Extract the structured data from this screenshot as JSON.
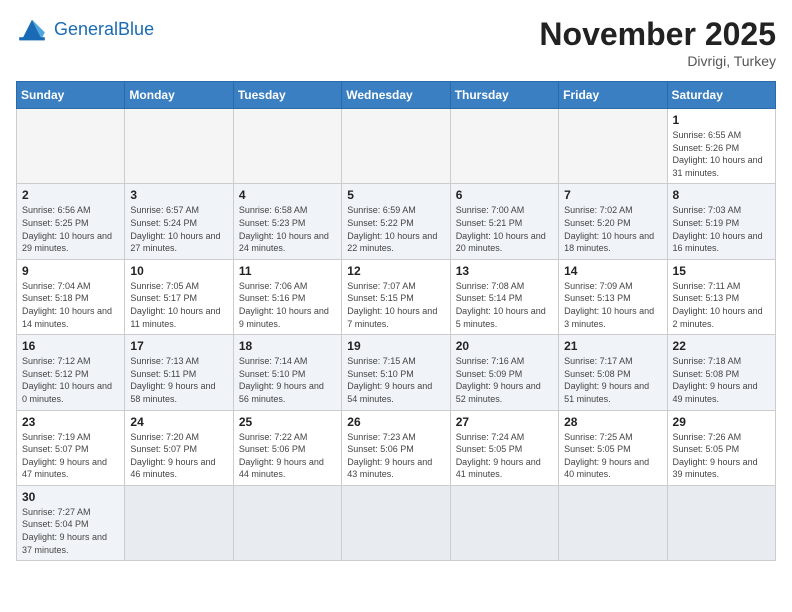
{
  "header": {
    "logo_general": "General",
    "logo_blue": "Blue",
    "month_year": "November 2025",
    "location": "Divrigi, Turkey"
  },
  "weekdays": [
    "Sunday",
    "Monday",
    "Tuesday",
    "Wednesday",
    "Thursday",
    "Friday",
    "Saturday"
  ],
  "days": [
    {
      "day": "",
      "empty": true
    },
    {
      "day": "",
      "empty": true
    },
    {
      "day": "",
      "empty": true
    },
    {
      "day": "",
      "empty": true
    },
    {
      "day": "",
      "empty": true
    },
    {
      "day": "",
      "empty": true
    },
    {
      "day": "1",
      "sunrise": "6:55 AM",
      "sunset": "5:26 PM",
      "daylight": "10 hours and 31 minutes."
    },
    {
      "day": "2",
      "sunrise": "6:56 AM",
      "sunset": "5:25 PM",
      "daylight": "10 hours and 29 minutes."
    },
    {
      "day": "3",
      "sunrise": "6:57 AM",
      "sunset": "5:24 PM",
      "daylight": "10 hours and 27 minutes."
    },
    {
      "day": "4",
      "sunrise": "6:58 AM",
      "sunset": "5:23 PM",
      "daylight": "10 hours and 24 minutes."
    },
    {
      "day": "5",
      "sunrise": "6:59 AM",
      "sunset": "5:22 PM",
      "daylight": "10 hours and 22 minutes."
    },
    {
      "day": "6",
      "sunrise": "7:00 AM",
      "sunset": "5:21 PM",
      "daylight": "10 hours and 20 minutes."
    },
    {
      "day": "7",
      "sunrise": "7:02 AM",
      "sunset": "5:20 PM",
      "daylight": "10 hours and 18 minutes."
    },
    {
      "day": "8",
      "sunrise": "7:03 AM",
      "sunset": "5:19 PM",
      "daylight": "10 hours and 16 minutes."
    },
    {
      "day": "9",
      "sunrise": "7:04 AM",
      "sunset": "5:18 PM",
      "daylight": "10 hours and 14 minutes."
    },
    {
      "day": "10",
      "sunrise": "7:05 AM",
      "sunset": "5:17 PM",
      "daylight": "10 hours and 11 minutes."
    },
    {
      "day": "11",
      "sunrise": "7:06 AM",
      "sunset": "5:16 PM",
      "daylight": "10 hours and 9 minutes."
    },
    {
      "day": "12",
      "sunrise": "7:07 AM",
      "sunset": "5:15 PM",
      "daylight": "10 hours and 7 minutes."
    },
    {
      "day": "13",
      "sunrise": "7:08 AM",
      "sunset": "5:14 PM",
      "daylight": "10 hours and 5 minutes."
    },
    {
      "day": "14",
      "sunrise": "7:09 AM",
      "sunset": "5:13 PM",
      "daylight": "10 hours and 3 minutes."
    },
    {
      "day": "15",
      "sunrise": "7:11 AM",
      "sunset": "5:13 PM",
      "daylight": "10 hours and 2 minutes."
    },
    {
      "day": "16",
      "sunrise": "7:12 AM",
      "sunset": "5:12 PM",
      "daylight": "10 hours and 0 minutes."
    },
    {
      "day": "17",
      "sunrise": "7:13 AM",
      "sunset": "5:11 PM",
      "daylight": "9 hours and 58 minutes."
    },
    {
      "day": "18",
      "sunrise": "7:14 AM",
      "sunset": "5:10 PM",
      "daylight": "9 hours and 56 minutes."
    },
    {
      "day": "19",
      "sunrise": "7:15 AM",
      "sunset": "5:10 PM",
      "daylight": "9 hours and 54 minutes."
    },
    {
      "day": "20",
      "sunrise": "7:16 AM",
      "sunset": "5:09 PM",
      "daylight": "9 hours and 52 minutes."
    },
    {
      "day": "21",
      "sunrise": "7:17 AM",
      "sunset": "5:08 PM",
      "daylight": "9 hours and 51 minutes."
    },
    {
      "day": "22",
      "sunrise": "7:18 AM",
      "sunset": "5:08 PM",
      "daylight": "9 hours and 49 minutes."
    },
    {
      "day": "23",
      "sunrise": "7:19 AM",
      "sunset": "5:07 PM",
      "daylight": "9 hours and 47 minutes."
    },
    {
      "day": "24",
      "sunrise": "7:20 AM",
      "sunset": "5:07 PM",
      "daylight": "9 hours and 46 minutes."
    },
    {
      "day": "25",
      "sunrise": "7:22 AM",
      "sunset": "5:06 PM",
      "daylight": "9 hours and 44 minutes."
    },
    {
      "day": "26",
      "sunrise": "7:23 AM",
      "sunset": "5:06 PM",
      "daylight": "9 hours and 43 minutes."
    },
    {
      "day": "27",
      "sunrise": "7:24 AM",
      "sunset": "5:05 PM",
      "daylight": "9 hours and 41 minutes."
    },
    {
      "day": "28",
      "sunrise": "7:25 AM",
      "sunset": "5:05 PM",
      "daylight": "9 hours and 40 minutes."
    },
    {
      "day": "29",
      "sunrise": "7:26 AM",
      "sunset": "5:05 PM",
      "daylight": "9 hours and 39 minutes."
    },
    {
      "day": "30",
      "sunrise": "7:27 AM",
      "sunset": "5:04 PM",
      "daylight": "9 hours and 37 minutes."
    },
    {
      "day": "",
      "empty": true
    },
    {
      "day": "",
      "empty": true
    },
    {
      "day": "",
      "empty": true
    },
    {
      "day": "",
      "empty": true
    },
    {
      "day": "",
      "empty": true
    },
    {
      "day": "",
      "empty": true
    }
  ]
}
